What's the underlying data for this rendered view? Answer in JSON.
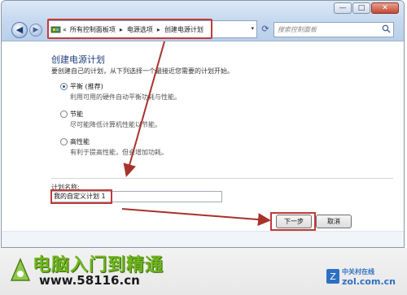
{
  "window": {
    "controls": {
      "minimize": "—",
      "maximize": "□",
      "close": "✕"
    }
  },
  "nav": {
    "back_icon": "◀",
    "forward_icon": "▶",
    "refresh_icon": "⟳"
  },
  "address": {
    "prefix": "«",
    "crumbs": [
      "所有控制面板项",
      "电源选项",
      "创建电源计划"
    ],
    "separator": "▸",
    "dropdown": "▾"
  },
  "search": {
    "placeholder": "搜索控制面板"
  },
  "page": {
    "title": "创建电源计划",
    "description": "要创建自己的计划，从下列选择一个最接近您需要的计划开始。"
  },
  "options": [
    {
      "title": "平衡 (推荐)",
      "desc": "利用可用的硬件自动平衡功耗与性能。",
      "checked": true
    },
    {
      "title": "节能",
      "desc": "尽可能降低计算机性能以节能。",
      "checked": false
    },
    {
      "title": "高性能",
      "desc": "有利于提高性能，但会增加功耗。",
      "checked": false
    }
  ],
  "plan_name": {
    "label": "计划名称:",
    "value": "我的自定义计划 1"
  },
  "buttons": {
    "next": "下一步",
    "cancel": "取消"
  },
  "banner": {
    "title": "电脑入门到精通",
    "url": "www.58116.cn",
    "brand_name": "中关村在线",
    "brand_domain": "zol.com.cn"
  },
  "colors": {
    "annotation_red": "#c23a3a",
    "title_blue": "#1e3d7a",
    "banner_green": "#6fb51e"
  }
}
